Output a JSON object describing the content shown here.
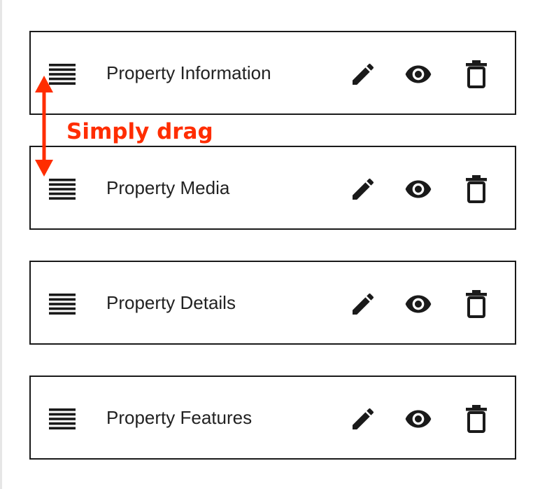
{
  "colors": {
    "accent": "#ff2d00",
    "text": "#222222",
    "border": "#1a1a1a",
    "icon": "#1a1a1a"
  },
  "annotation": {
    "text": "Simply drag"
  },
  "icons": {
    "handle": "drag-handle-icon",
    "edit": "pencil-icon",
    "view": "eye-icon",
    "delete": "trash-icon",
    "arrow": "double-arrow-icon"
  },
  "rows": [
    {
      "label": "Property Information"
    },
    {
      "label": "Property Media"
    },
    {
      "label": "Property Details"
    },
    {
      "label": "Property Features"
    }
  ]
}
